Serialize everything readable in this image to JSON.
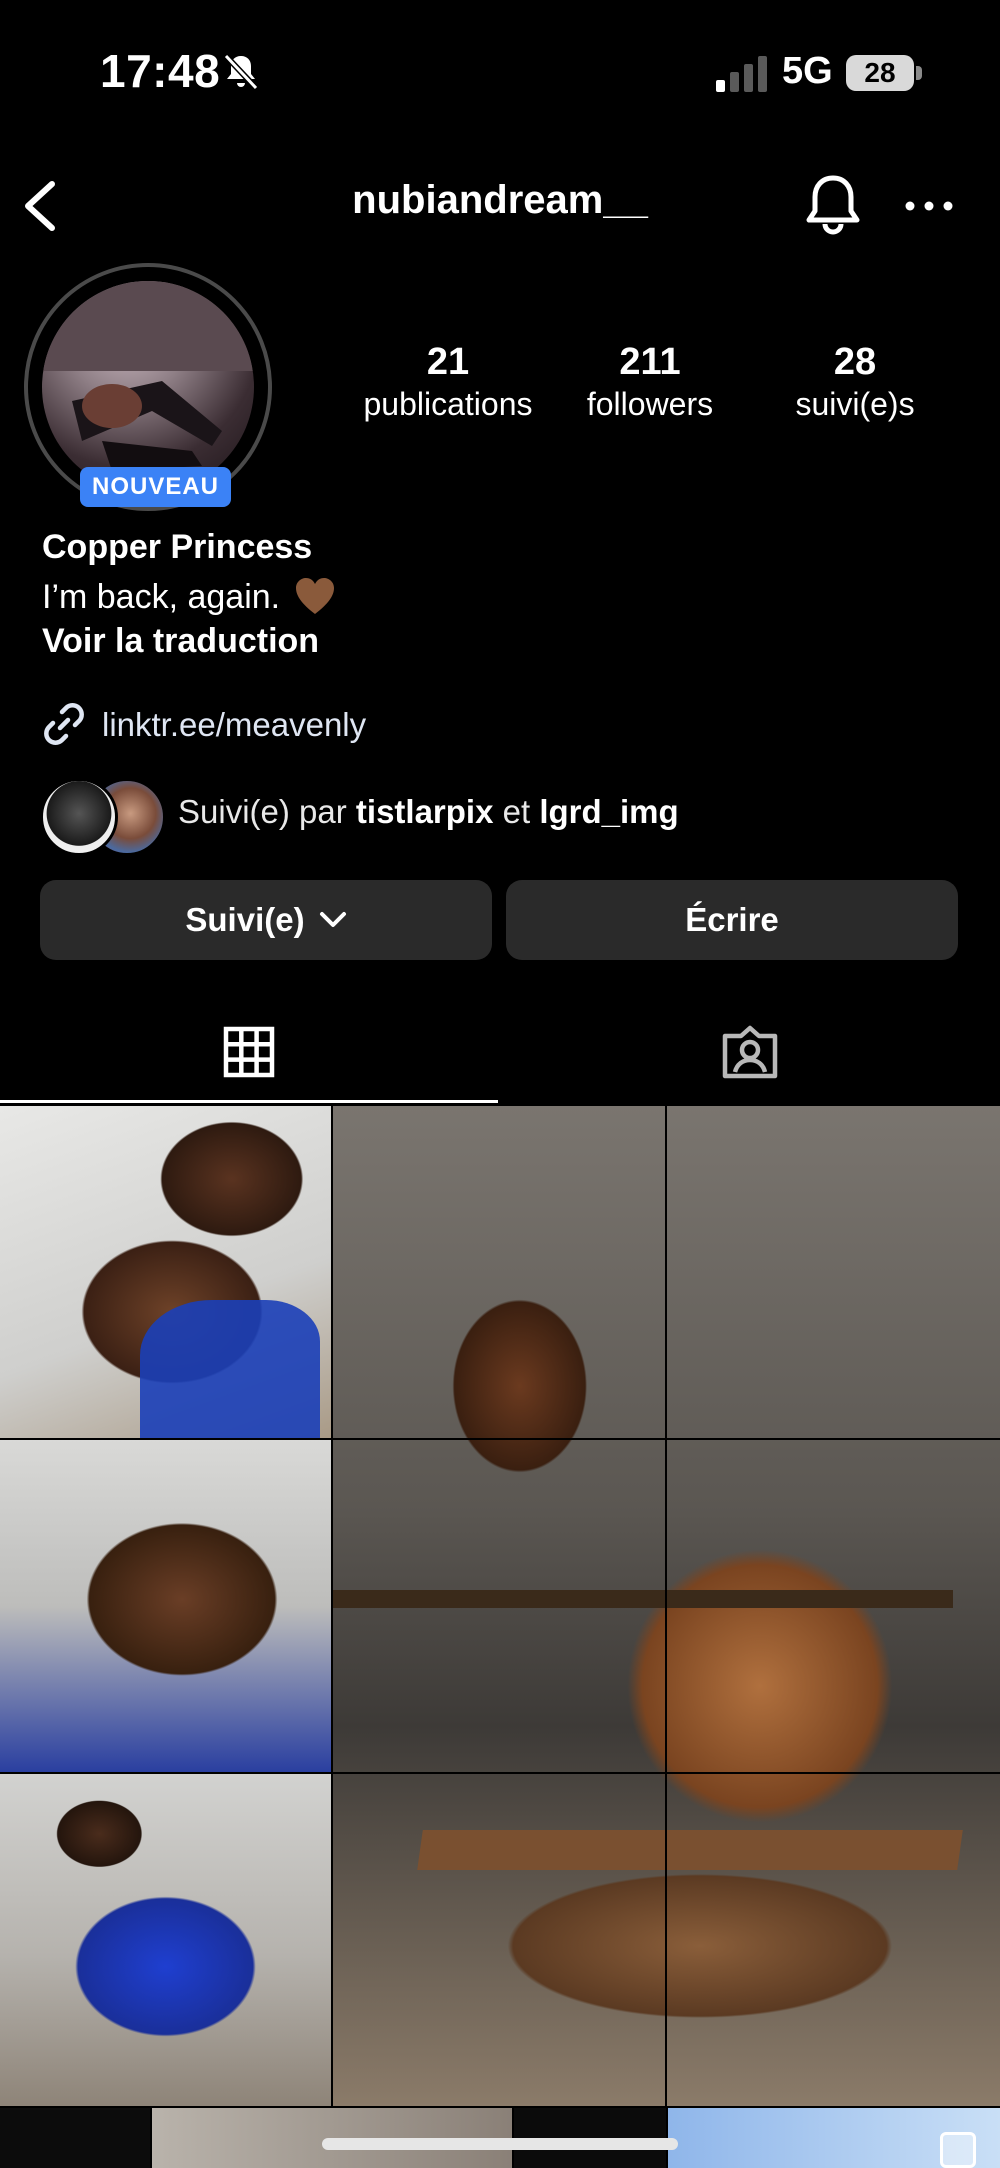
{
  "status_bar": {
    "time": "17:48",
    "network": "5G",
    "battery": "28"
  },
  "header": {
    "username": "nubiandream__"
  },
  "profile": {
    "badge": "NOUVEAU",
    "stats": [
      {
        "value": "21",
        "label": "publications"
      },
      {
        "value": "211",
        "label": "followers"
      },
      {
        "value": "28",
        "label": "suivi(e)s"
      }
    ],
    "display_name": "Copper Princess",
    "bio": "I’m back, again.",
    "translate_label": "Voir la traduction",
    "link": "linktr.ee/meavenly",
    "followed_by": {
      "prefix": "Suivi(e) par",
      "user1": "tistlarpix",
      "conj": "et",
      "user2": "lgrd_img"
    }
  },
  "actions": {
    "follow_label": "Suivi(e)",
    "message_label": "Écrire"
  },
  "icons": {
    "back": "chevron-left-icon",
    "notifications": "bell-icon",
    "more": "more-horizontal-icon",
    "link": "link-icon",
    "grid": "grid-icon",
    "tagged": "tagged-icon"
  }
}
